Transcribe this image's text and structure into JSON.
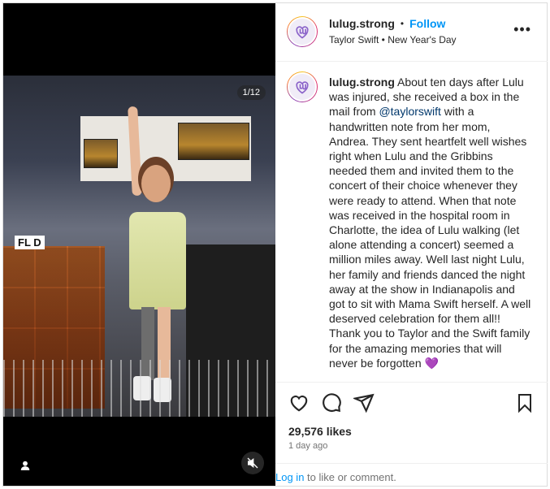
{
  "post": {
    "username": "lulug.strong",
    "separator": "•",
    "follow_label": "Follow",
    "subtitle": "Taylor Swift • New Year's Day",
    "more_label": "•••",
    "image_counter": "1/12",
    "photo_sign": "FL D",
    "caption_username": "lulug.strong",
    "caption_part1": " About ten days after Lulu was injured, she received a box in the mail from ",
    "caption_mention": "@taylorswift",
    "caption_part2": " with a handwritten note from her mom, Andrea. They sent heartfelt well wishes right when Lulu and the Gribbins needed them and invited them to the concert of their choice whenever they were ready to attend. When that note was received in the hospital room in Charlotte, the idea of Lulu walking (let alone attending a concert) seemed a million miles away. Well last night Lulu, her family and friends danced the night away at the show in Indianapolis and got to sit with Mama Swift herself. A well deserved celebration for them all!! Thank you to Taylor and the Swift family for the amazing memories that will never be forgotten ",
    "caption_emoji": "💜",
    "likes": "29,576 likes",
    "time_ago": "1 day ago",
    "login_label": "Log in",
    "comment_prompt": " to like or comment."
  },
  "icons": {
    "like": "heart-icon",
    "comment": "comment-icon",
    "share": "share-icon",
    "save": "bookmark-icon",
    "user_tag": "user-tag-icon",
    "mute": "muted-speaker-icon"
  },
  "colors": {
    "link_blue": "#0095f6",
    "mention_blue": "#00376b",
    "text": "#262626",
    "muted": "#737373"
  }
}
